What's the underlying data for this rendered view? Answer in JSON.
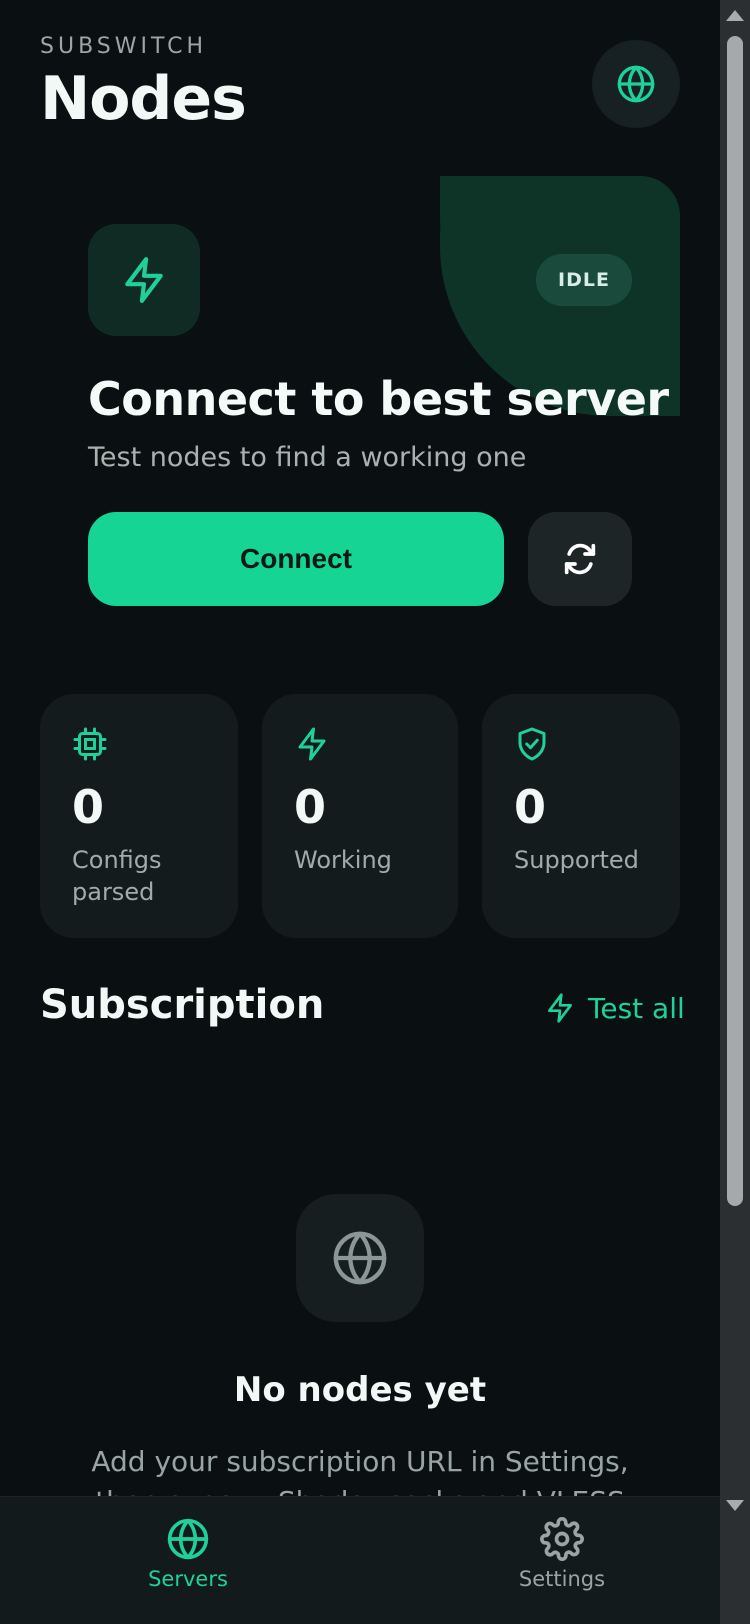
{
  "header": {
    "brand": "SUBSWITCH",
    "title": "Nodes"
  },
  "hero": {
    "status": "IDLE",
    "title": "Connect to best server",
    "subtitle": "Test nodes to find a working one",
    "connect_label": "Connect"
  },
  "stats": [
    {
      "icon": "chip-icon",
      "value": "0",
      "label": "Configs parsed"
    },
    {
      "icon": "bolt-icon",
      "value": "0",
      "label": "Working"
    },
    {
      "icon": "shield-check-icon",
      "value": "0",
      "label": "Supported"
    }
  ],
  "subscription": {
    "title": "Subscription",
    "test_all_label": "Test all"
  },
  "empty": {
    "title": "No nodes yet",
    "description": "Add your subscription URL in Settings, then sync — Shadowsocks and VLESS"
  },
  "nav": [
    {
      "icon": "globe-icon",
      "label": "Servers",
      "active": true
    },
    {
      "icon": "gear-icon",
      "label": "Settings",
      "active": false
    }
  ],
  "colors": {
    "accent": "#16d494",
    "background": "#0a1012",
    "card": "#141b1d",
    "hero_blob": "#0e3428"
  }
}
